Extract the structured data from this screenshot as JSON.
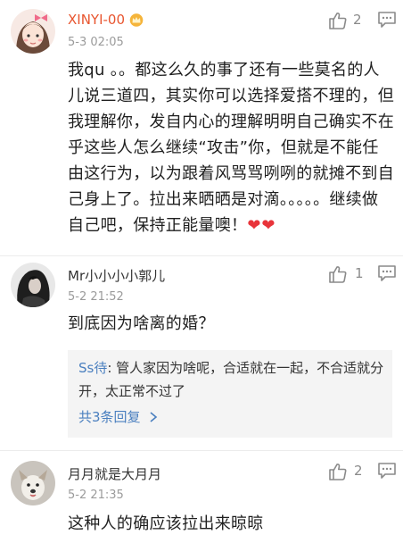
{
  "comments": [
    {
      "username": "XINYI-00",
      "time": "5-3 02:05",
      "likes": "2",
      "text": "我qu 。。都这么久的事了还有一些莫名的人儿说三道四，其实你可以选择爱搭不理的，但我理解你，发自内心的理解明明自己确实不在乎这些人怎么继续“攻击”你，但就是不能任由这行为，以为跟着风骂骂咧咧的就摊不到自己身上了。拉出来晒晒是对滴。。。。。继续做自己吧，保持正能量噢！",
      "emoji": "❤❤",
      "name_color": "#e8552f"
    },
    {
      "username": "Mr小小小小郭儿",
      "time": "5-2 21:52",
      "likes": "1",
      "text": "到底因为啥离的婚？",
      "reply": {
        "author": "Ss待",
        "text": ": 管人家因为啥呢，合适就在一起，不合适就分开，太正常不过了",
        "more": "共3条回复"
      }
    },
    {
      "username": "月月就是大月月",
      "time": "5-2 21:35",
      "likes": "2",
      "text": "这种人的确应该拉出来晾晾"
    }
  ],
  "icons": {
    "like": "thumbs-up-icon",
    "reply": "comment-bubble-icon",
    "crown": "crown-icon",
    "more": "chevron-right-icon"
  },
  "colors": {
    "link": "#4a7fbf",
    "heart": "#e8343a",
    "vip_name": "#e8552f"
  }
}
